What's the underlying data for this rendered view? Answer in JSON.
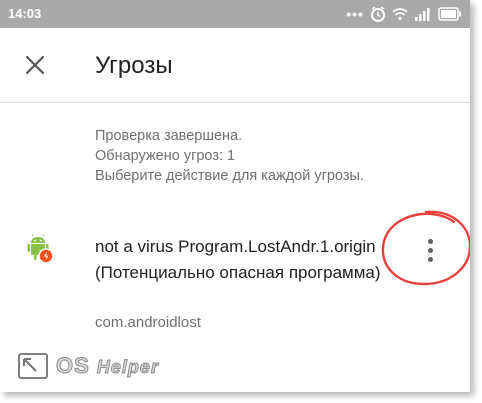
{
  "status_bar": {
    "time": "14:03",
    "icons": [
      "more-dots-icon",
      "alarm-icon",
      "wifi-icon",
      "signal-icon",
      "battery-icon"
    ]
  },
  "app_bar": {
    "close_icon": "close-icon",
    "title": "Угрозы"
  },
  "summary": {
    "line1": "Проверка завершена.",
    "line2": "Обнаружено угроз: 1",
    "line3": "Выберите действие для каждой угрозы."
  },
  "threat": {
    "icon": "android-warning-icon",
    "name": "not a virus Program.LostAndr.1.origin (Потенциально опасная программа)",
    "package": "com.androidlost",
    "menu_icon": "more-vert-icon"
  },
  "watermark": {
    "text_os": "OS",
    "text_helper": "Helper"
  },
  "colors": {
    "status_bar": "#a9a9a9",
    "highlight": "#e8413e",
    "android_green": "#8bc34a",
    "warning_orange": "#f4511e"
  }
}
